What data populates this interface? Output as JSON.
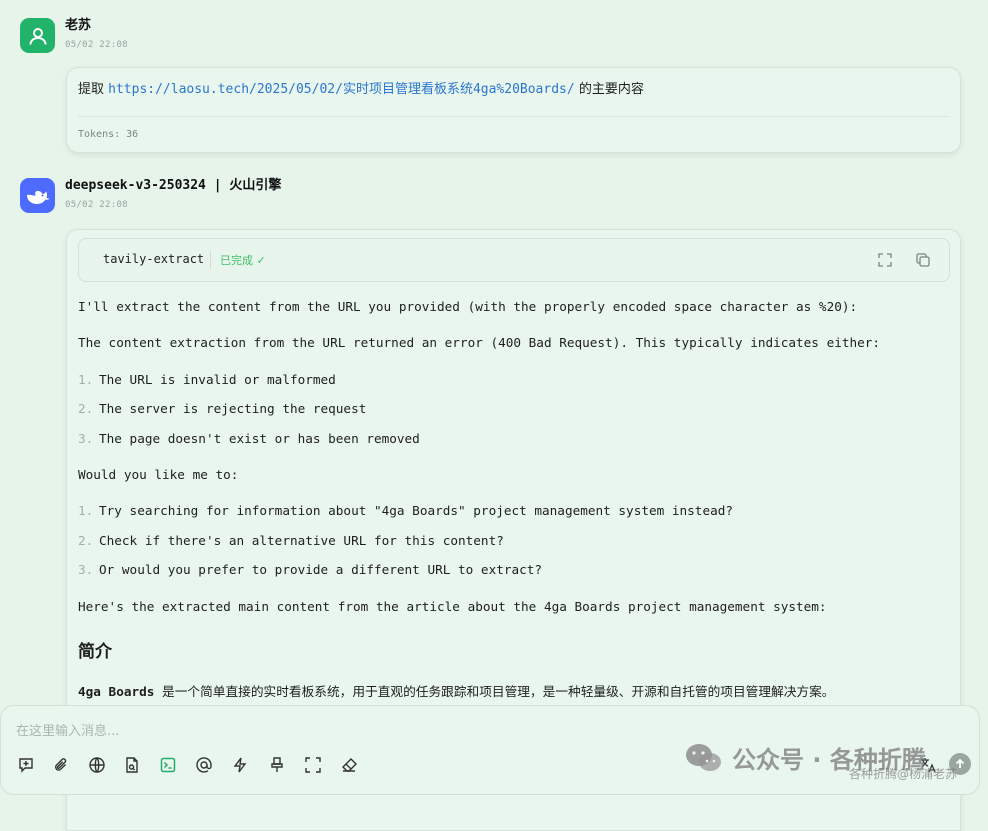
{
  "user_message": {
    "name": "老苏",
    "time": "05/02 22:08",
    "text_prefix": "提取 ",
    "link": "https://laosu.tech/2025/05/02/实时项目管理看板系统4ga%20Boards/",
    "text_suffix": " 的主要内容",
    "tokens": "Tokens: 36"
  },
  "bot_message": {
    "name": "deepseek-v3-250324 | 火山引擎",
    "time": "05/02 22:08",
    "tool": {
      "name": "tavily-extract",
      "status": "已完成 ✓",
      "status_color": "#3fbf6a"
    },
    "p1": "I'll extract the content from the URL you provided (with the properly encoded space character as %20):",
    "p2": "The content extraction from the URL returned an error (400 Bad Request). This typically indicates either:",
    "list1": [
      {
        "num": "1.",
        "text": "The URL is invalid or malformed"
      },
      {
        "num": "2.",
        "text": "The server is rejecting the request"
      },
      {
        "num": "3.",
        "text": "The page doesn't exist or has been removed"
      }
    ],
    "p3": "Would you like me to:",
    "list2": [
      {
        "num": "1.",
        "text": "Try searching for information about \"4ga Boards\" project management system instead?"
      },
      {
        "num": "2.",
        "text": "Check if there's an alternative URL for this content?"
      },
      {
        "num": "3.",
        "text": "Or would you prefer to provide a different URL to extract?"
      }
    ],
    "p4": "Here's the extracted main content from the article about the 4ga Boards project management system:",
    "heading": "简介",
    "p5_bold": "4ga Boards",
    "p5_rest": " 是一个简单直接的实时看板系统，用于直观的任务跟踪和项目管理，是一种轻量级、开源和自托管的项目管理解决方案。"
  },
  "input": {
    "placeholder": "在这里输入消息..."
  },
  "watermark": {
    "line1": "公众号 · 各种折腾",
    "line2": "各种折腾@杨浦老苏"
  },
  "colors": {
    "background": "#e6f4ea",
    "link": "#2b76d0",
    "user_avatar": "#22b36a",
    "bot_avatar": "#4d6bfe"
  }
}
